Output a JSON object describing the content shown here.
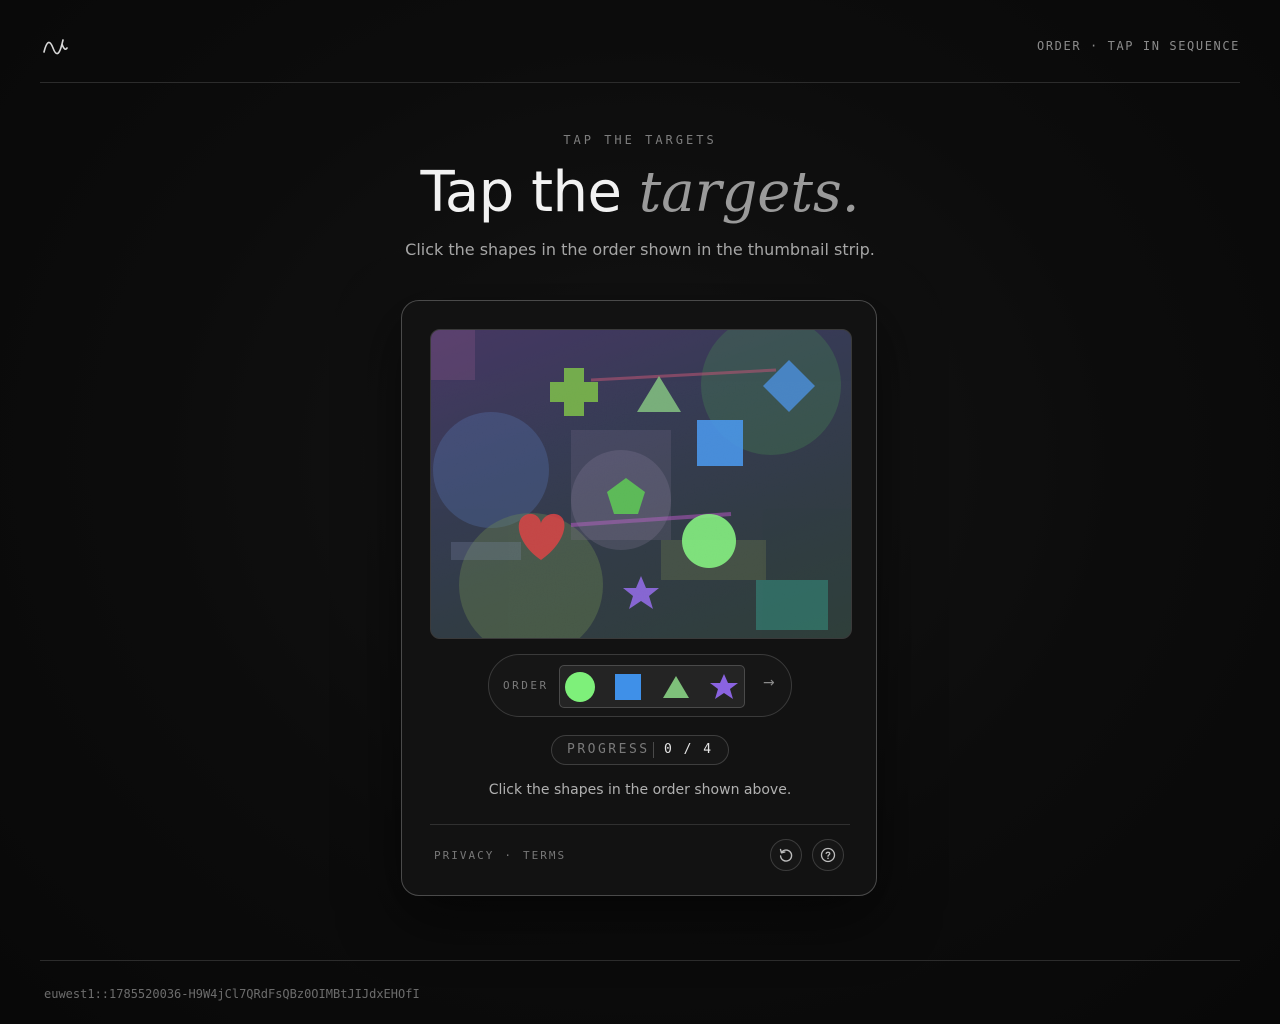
{
  "header": {
    "logo_icon": "wave-logo-icon",
    "meta": "ORDER · TAP IN SEQUENCE"
  },
  "hero": {
    "eyebrow": "TAP THE TARGETS",
    "title_main": "Tap the ",
    "title_accent": "targets.",
    "subtitle": "Click the shapes in the order shown in the thumbnail strip."
  },
  "canvas": {
    "shapes": [
      {
        "name": "plus-shape",
        "color": "#7cc63f"
      },
      {
        "name": "triangle-shape",
        "color": "#7ec07a"
      },
      {
        "name": "diamond-shape",
        "color": "#3f86d6"
      },
      {
        "name": "square-shape",
        "color": "#3f90e8"
      },
      {
        "name": "pentagon-shape",
        "color": "#55c94a"
      },
      {
        "name": "heart-shape",
        "color": "#d8383a"
      },
      {
        "name": "circle-shape",
        "color": "#7ef07a"
      },
      {
        "name": "star-shape",
        "color": "#8a63e0"
      }
    ]
  },
  "order": {
    "label": "ORDER",
    "thumbnails": [
      {
        "name": "circle-thumb",
        "icon": "circle",
        "color": "#7ef07a"
      },
      {
        "name": "square-thumb",
        "icon": "square",
        "color": "#3f90e8"
      },
      {
        "name": "triangle-thumb",
        "icon": "triangle",
        "color": "#7ec07a"
      },
      {
        "name": "star-thumb",
        "icon": "star",
        "color": "#8a63e0"
      }
    ],
    "next_symbol": "→"
  },
  "progress": {
    "label": "PROGRESS",
    "value": "0 / 4"
  },
  "instruction": "Click the shapes in the order shown above.",
  "legal": {
    "privacy": "PRIVACY",
    "separator": "·",
    "terms": "TERMS"
  },
  "actions": {
    "reload_icon": "reload-icon",
    "help_icon": "help-icon"
  },
  "footer": {
    "session_id": "euwest1::1785520036-H9W4jCl7QRdFsQBz0OIMBtJIJdxEHOfI"
  }
}
